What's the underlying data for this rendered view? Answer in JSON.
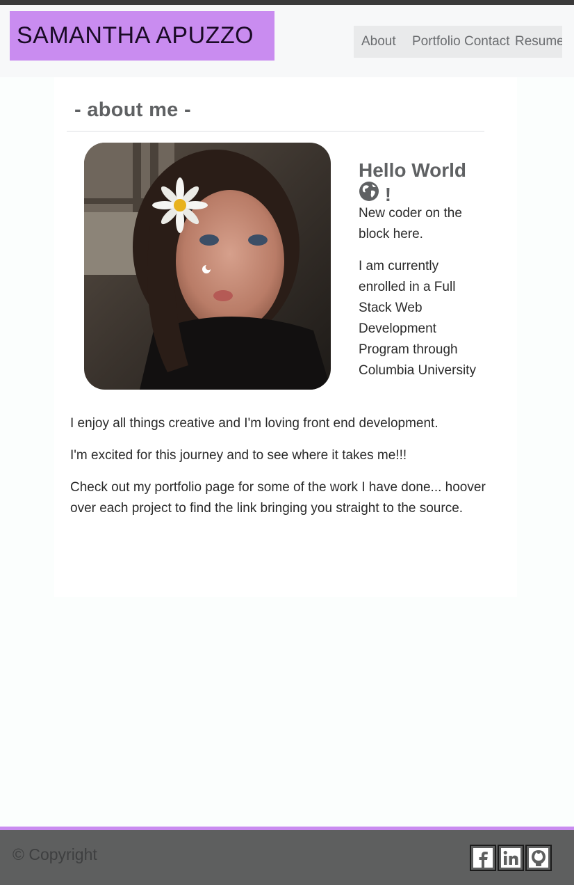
{
  "navbar": {
    "brand_first": "SAMANTHA",
    "brand_last": "APUZZO",
    "links": [
      "About",
      "Portfolio",
      "Contact",
      "Resume"
    ]
  },
  "about": {
    "section_title": "- about me -",
    "greeting": "Hello World",
    "greeting_icon": "globe-icon",
    "greeting_suffix": "!",
    "intro": "New coder on the block here.",
    "enrollment": "I am currently enrolled in a Full Stack Web Development Program through Columbia University",
    "creative": "I enjoy all things creative and I'm loving front end development.",
    "journey": "I'm excited for this journey and to see where it takes me!!!",
    "portfolio_note": "Check out my portfolio page for some of the work I have done... hoover over each project to find the link bringing you straight to the source."
  },
  "footer": {
    "copyright": "© Copyright",
    "social_icons": [
      "facebook-icon",
      "linkedin-icon",
      "github-icon"
    ]
  },
  "colors": {
    "accent": "#c98cf0",
    "footer_bg": "#5e5f5f",
    "top_strip": "#3a3a3a"
  }
}
